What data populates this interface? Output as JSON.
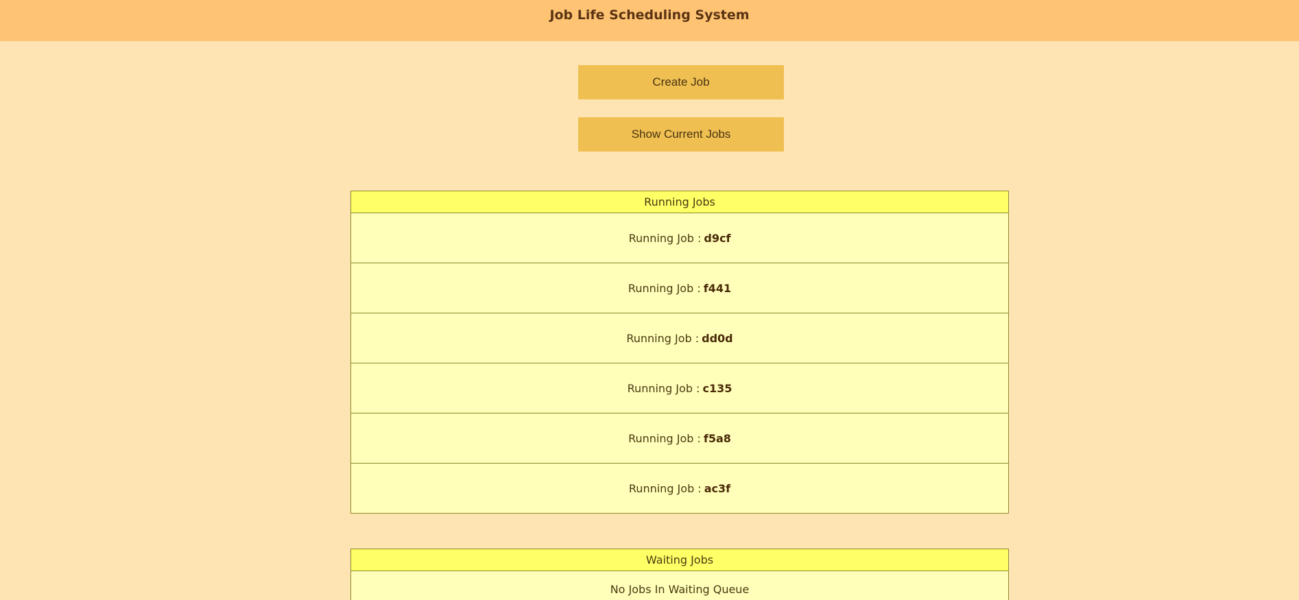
{
  "header": {
    "title": "Job Life Scheduling System"
  },
  "actions": {
    "create_label": "Create Job",
    "show_label": "Show Current Jobs"
  },
  "running": {
    "title": "Running Jobs",
    "prefix": "Running Job :",
    "jobs": [
      "d9cf",
      "f441",
      "dd0d",
      "c135",
      "f5a8",
      "ac3f"
    ]
  },
  "waiting": {
    "title": "Waiting Jobs",
    "empty_text": "No Jobs In Waiting Queue"
  },
  "colors": {
    "background": "#ffe4b3",
    "header": "#ffc374",
    "button": "#efbf52",
    "panel_head": "#ffff66",
    "panel_body": "#ffffba"
  }
}
